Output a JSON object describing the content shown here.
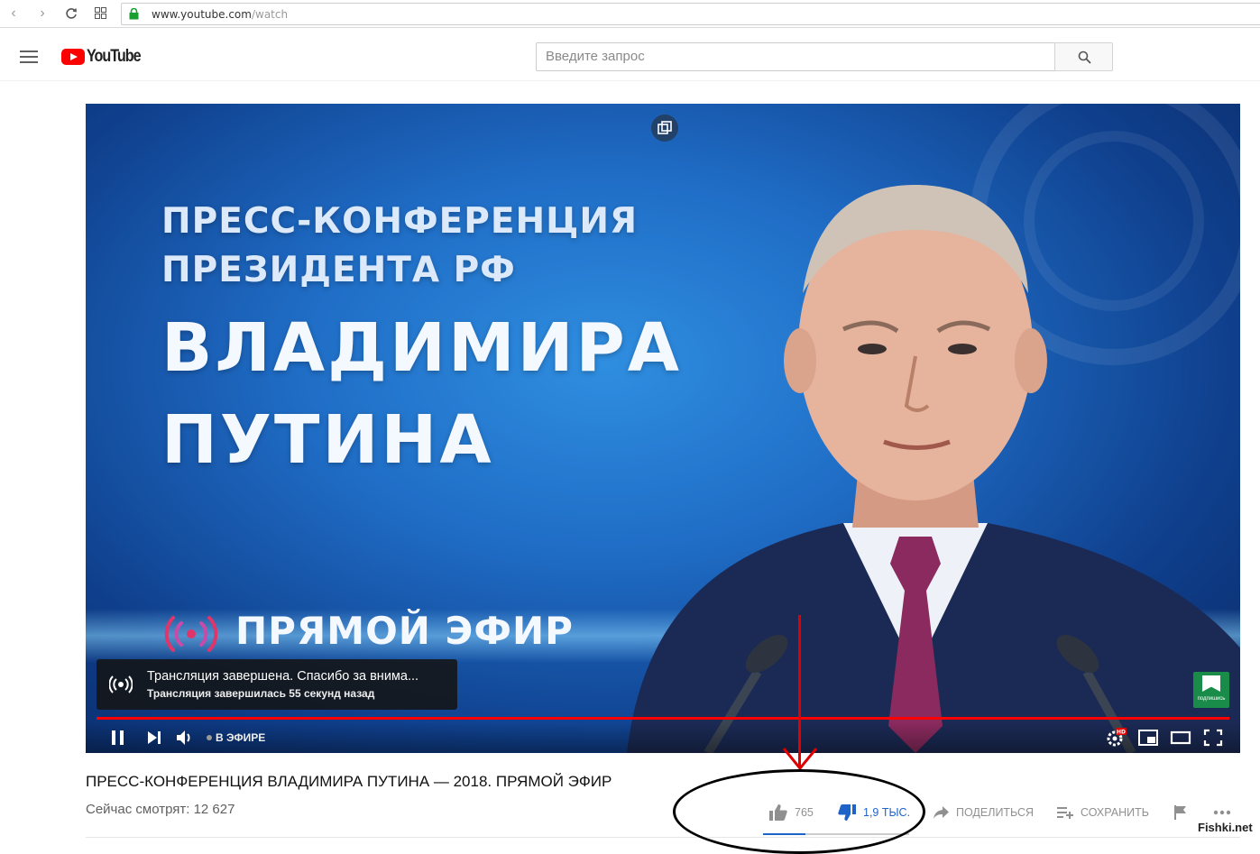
{
  "browser": {
    "url_host": "www.youtube.com",
    "url_path": "/watch"
  },
  "header": {
    "logo_text": "YouTube",
    "search_placeholder": "Введите запрос"
  },
  "video": {
    "headline_line1": "ПРЕСС-КОНФЕРЕНЦИЯ",
    "headline_line2": "ПРЕЗИДЕНТА РФ",
    "headline_line3": "ВЛАДИМИРА",
    "headline_line4": "ПУТИНА",
    "live_banner": "ПРЯМОЙ ЭФИР",
    "toast_title": "Трансляция завершена. Спасибо за внима...",
    "toast_subtitle": "Трансляция завершилась 55 секунд назад",
    "watermark_caption": "подпишись",
    "live_badge": "В ЭФИРЕ",
    "progress_fraction": 1.0,
    "hd_badge": "HD"
  },
  "info": {
    "title": "ПРЕСС-КОНФЕРЕНЦИЯ ВЛАДИМИРА ПУТИНА — 2018. ПРЯМОЙ ЭФИР",
    "viewers": "Сейчас смотрят: 12 627",
    "likes": "765",
    "dislikes": "1,9 ТЫС.",
    "share_label": "ПОДЕЛИТЬСЯ",
    "save_label": "СОХРАНИТЬ",
    "like_ratio": 0.29
  },
  "credit": "Fishki.net",
  "colors": {
    "brand_red": "#ff0000",
    "dislike_active": "#1e64c8",
    "annotation_red": "#e00000"
  }
}
